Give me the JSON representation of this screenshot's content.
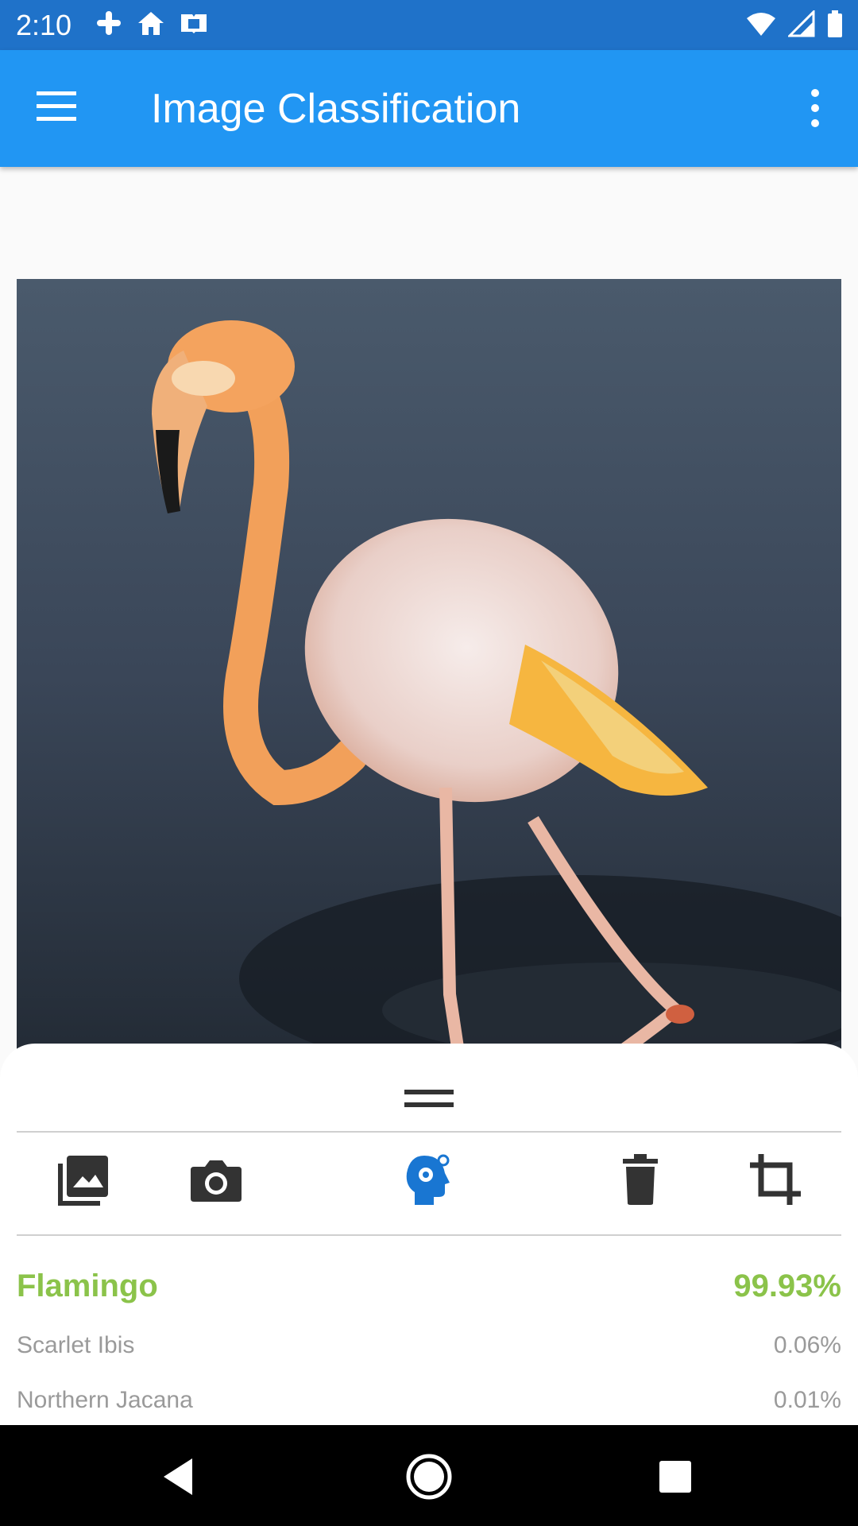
{
  "status_bar": {
    "time": "2:10",
    "left_icons": [
      "slack-icon",
      "home-icon",
      "kindle-icon"
    ],
    "right_icons": [
      "wifi-icon",
      "signal-icon",
      "battery-icon"
    ]
  },
  "app_bar": {
    "title": "Image Classification",
    "menu_icon": "hamburger-menu-icon",
    "more_icon": "more-vert-icon",
    "color": "#2196f3"
  },
  "image": {
    "subject": "flamingo photo"
  },
  "toolbar": {
    "icons": [
      "gallery-icon",
      "camera-icon",
      "classify-brain-icon",
      "delete-icon",
      "crop-icon"
    ],
    "active_icon_color": "#1976d2"
  },
  "results": {
    "top": {
      "label": "Flamingo",
      "confidence": "99.93%",
      "color": "#8bc34a"
    },
    "others": [
      {
        "label": "Scarlet Ibis",
        "confidence": "0.06%"
      },
      {
        "label": "Northern Jacana",
        "confidence": "0.01%"
      }
    ]
  },
  "nav_bar": {
    "icons": [
      "back-icon",
      "home-circle-icon",
      "recents-icon"
    ]
  }
}
